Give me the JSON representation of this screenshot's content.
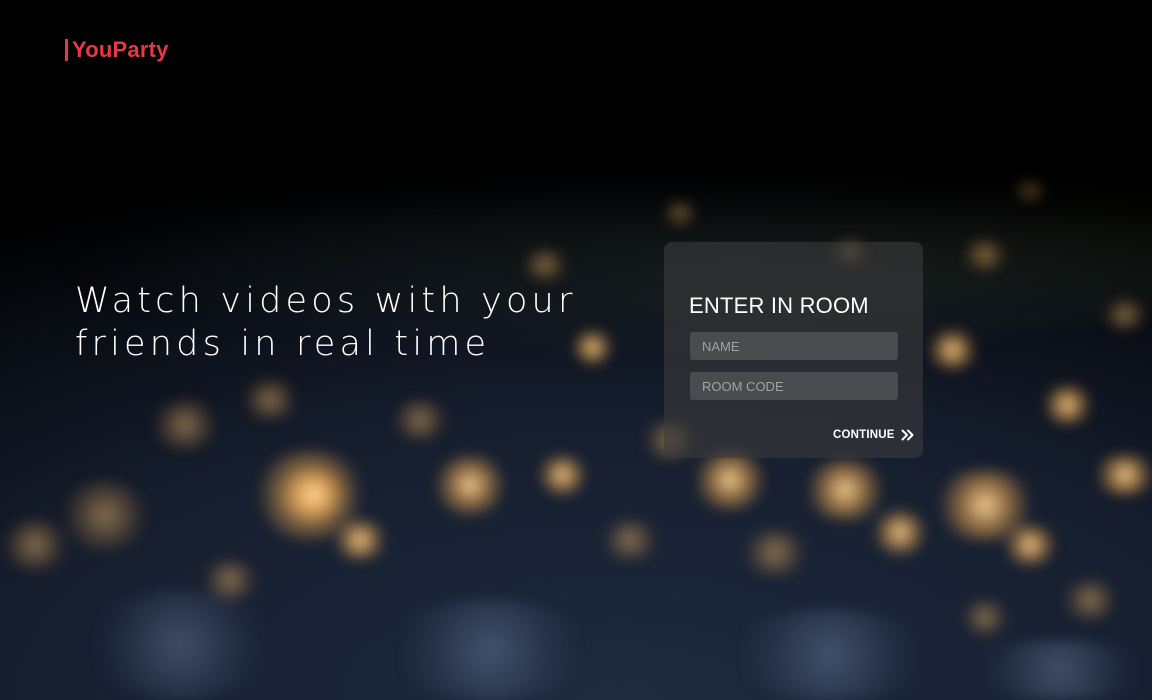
{
  "app": {
    "logo_text": "YouParty",
    "accent_color": "#e53945"
  },
  "hero": {
    "headline_line1": "Watch videos with your",
    "headline_line2": "friends in real time"
  },
  "room_form": {
    "title": "ENTER IN ROOM",
    "name_placeholder": "NAME",
    "name_value": "",
    "room_code_placeholder": "ROOM CODE",
    "room_code_value": "",
    "continue_label": "CONTINUE",
    "continue_icon": "double-chevron-right-icon"
  },
  "background": {
    "description_icon": "earth-at-night-image"
  }
}
